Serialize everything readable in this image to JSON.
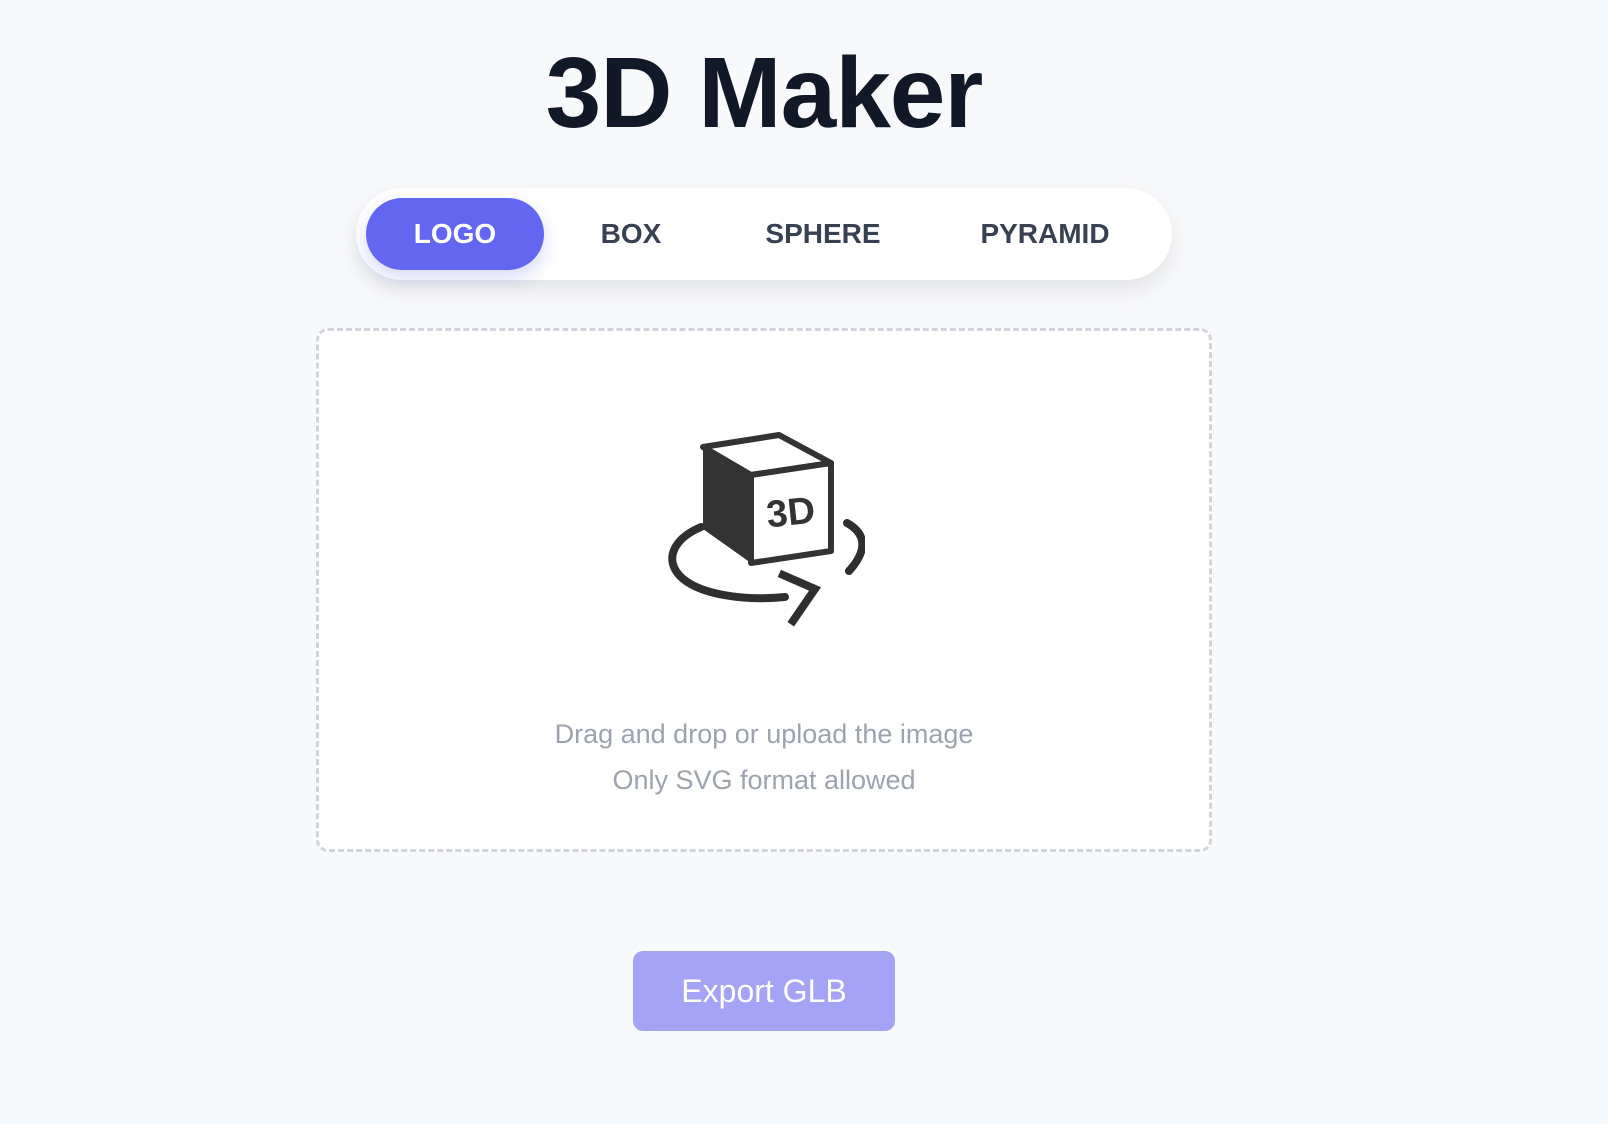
{
  "app": {
    "title": "3D Maker"
  },
  "tabs": [
    {
      "label": "LOGO",
      "active": true
    },
    {
      "label": "BOX",
      "active": false
    },
    {
      "label": "SPHERE",
      "active": false
    },
    {
      "label": "PYRAMID",
      "active": false
    }
  ],
  "dropzone": {
    "icon": "cube-3d-rotate-icon",
    "icon_text": "3D",
    "line1": "Drag and drop or upload the image",
    "line2": "Only SVG format allowed"
  },
  "export": {
    "label": "Export GLB"
  },
  "colors": {
    "accent": "#6366f1",
    "accent_disabled": "#a5a3f5",
    "background": "#f8f9fb",
    "title": "#111827",
    "muted_text": "#9ca3af"
  }
}
